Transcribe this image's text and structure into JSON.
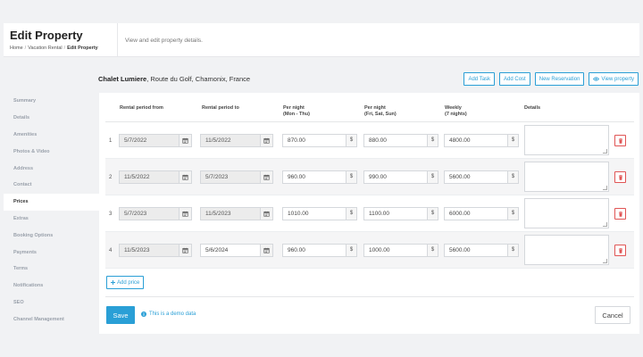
{
  "header": {
    "title": "Edit Property",
    "breadcrumb": [
      "Home",
      "Vacation Rental",
      "Edit Property"
    ],
    "description": "View and edit property details."
  },
  "property": {
    "name": "Chalet Lumiere",
    "address": ", Route du Golf, Chamonix, France"
  },
  "actions": {
    "add_task": "Add Task",
    "add_cost": "Add Cost",
    "new_reservation": "New Reservation",
    "view_property": "View property"
  },
  "sidebar": {
    "items": [
      {
        "label": "Summary"
      },
      {
        "label": "Details"
      },
      {
        "label": "Amenities"
      },
      {
        "label": "Photos & Video"
      },
      {
        "label": "Address"
      },
      {
        "label": "Contact"
      },
      {
        "label": "Prices"
      },
      {
        "label": "Extras"
      },
      {
        "label": "Booking Options"
      },
      {
        "label": "Payments"
      },
      {
        "label": "Terms"
      },
      {
        "label": "Notifications"
      },
      {
        "label": "SEO"
      },
      {
        "label": "Channel Management"
      }
    ],
    "active": "Prices"
  },
  "table": {
    "headers": {
      "from": "Rental period from",
      "to": "Rental period to",
      "weekday_line1": "Per night",
      "weekday_line2": "(Mon - Thu)",
      "weekend_line1": "Per night",
      "weekend_line2": "(Fri, Sat, Sun)",
      "weekly_line1": "Weekly",
      "weekly_line2": "(7 nights)",
      "details": "Details"
    },
    "currency": "$",
    "rows": [
      {
        "num": "1",
        "from": "5/7/2022",
        "to": "11/5/2022",
        "weekday": "870.00",
        "weekend": "880.00",
        "weekly": "4800.00"
      },
      {
        "num": "2",
        "from": "11/5/2022",
        "to": "5/7/2023",
        "weekday": "960.00",
        "weekend": "990.00",
        "weekly": "5600.00"
      },
      {
        "num": "3",
        "from": "5/7/2023",
        "to": "11/5/2023",
        "weekday": "1010.00",
        "weekend": "1100.00",
        "weekly": "6000.00"
      },
      {
        "num": "4",
        "from": "11/5/2023",
        "to": "5/6/2024",
        "weekday": "960.00",
        "weekend": "1000.00",
        "weekly": "5600.00"
      }
    ]
  },
  "buttons": {
    "add_price": "Add price",
    "save": "Save",
    "cancel": "Cancel"
  },
  "demo_note": "This is a demo data",
  "colors": {
    "accent": "#2a9fd6",
    "danger": "#e05555"
  }
}
